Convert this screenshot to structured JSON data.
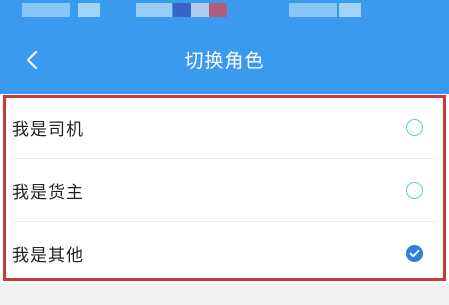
{
  "nav": {
    "title": "切换角色",
    "back_icon": "chevron-left-icon"
  },
  "options": [
    {
      "label": "我是司机",
      "selected": false
    },
    {
      "label": "我是货主",
      "selected": false
    },
    {
      "label": "我是其他",
      "selected": true
    }
  ],
  "colors": {
    "header": "#3a9bee",
    "highlight_border": "#c63b37",
    "radio_unselected": "#6cc7d6",
    "radio_selected": "#2d7fe0"
  }
}
